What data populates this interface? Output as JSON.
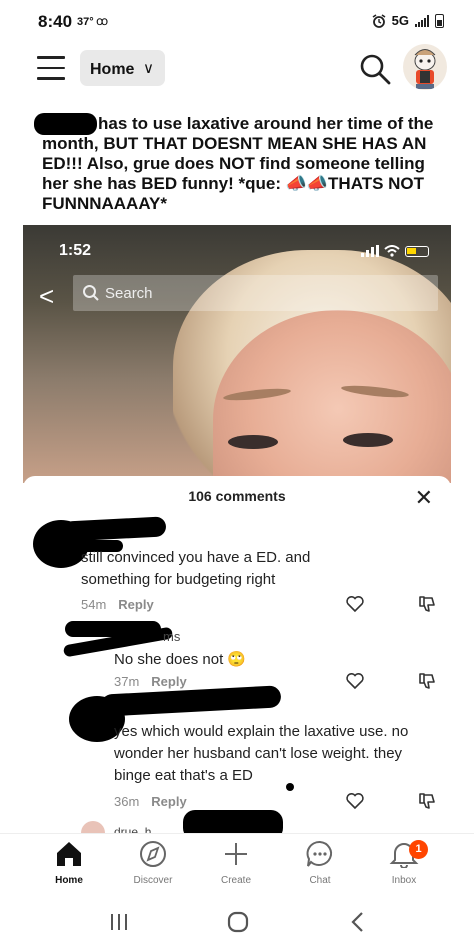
{
  "status_bar": {
    "time": "8:40",
    "temp": "37°",
    "voicemail": "ꝏ",
    "network": "5G"
  },
  "topbar": {
    "feed_label": "Home",
    "chevron": "∨"
  },
  "post": {
    "text": "has to use laxative around her time of the month, BUT THAT DOESNT MEAN SHE HAS AN ED!!! Also, grue does NOT find someone telling her she has BED funny! *que: 📣📣THATS NOT FUNNNAAAAY*"
  },
  "video": {
    "time": "1:52",
    "search_placeholder": "Search",
    "back": "<"
  },
  "comments_sheet": {
    "title": "106 comments",
    "close": "✕",
    "comments": [
      {
        "text": "still convinced you have a ED. and something for budgeting right",
        "time": "54m",
        "reply": "Reply"
      },
      {
        "name_tail": "ms",
        "text": "No she does not 🙄",
        "time": "37m",
        "reply": "Reply"
      },
      {
        "text": "yes which would explain the laxative use. no wonder her husband can't lose weight. they binge eat that's a ED",
        "time": "36m",
        "reply": "Reply"
      },
      {
        "name_partial": "drue_h"
      }
    ]
  },
  "bottom_nav": {
    "items": [
      {
        "label": "Home",
        "icon": "home-icon"
      },
      {
        "label": "Discover",
        "icon": "compass-icon"
      },
      {
        "label": "Create",
        "icon": "plus-icon"
      },
      {
        "label": "Chat",
        "icon": "chat-bubble-icon"
      },
      {
        "label": "Inbox",
        "icon": "bell-icon",
        "badge": "1"
      }
    ]
  },
  "colors": {
    "badge": "#ff4500",
    "text": "#111111",
    "muted": "#8a8a8a",
    "dropdown_bg": "#e9e9e9"
  }
}
